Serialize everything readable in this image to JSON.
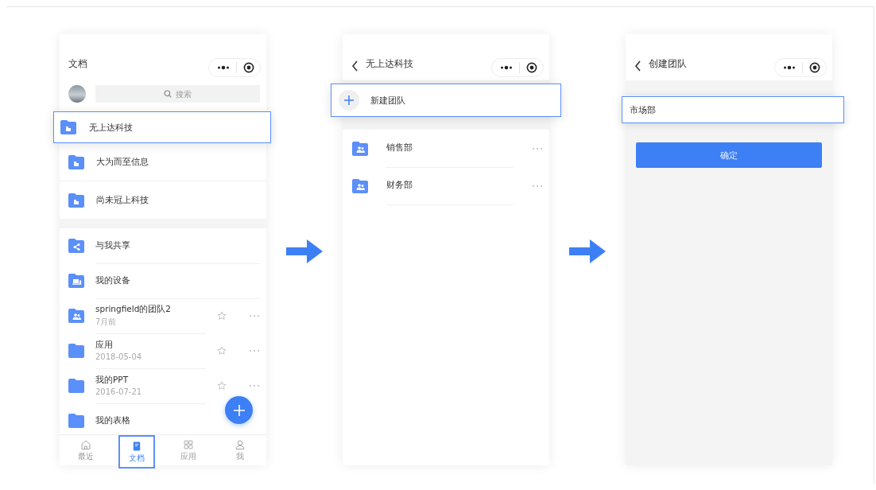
{
  "screens": [
    {
      "kind": "documents",
      "title": "文档",
      "search": {
        "placeholder": "搜索"
      },
      "teams": [
        {
          "name": "无上达科技",
          "highlighted": true
        },
        {
          "name": "大为而至信息",
          "highlighted": false
        },
        {
          "name": "尚未冠上科技",
          "highlighted": false
        }
      ],
      "files": [
        {
          "kind": "shared",
          "name": "与我共享",
          "actions": false
        },
        {
          "kind": "device",
          "name": "我的设备",
          "actions": false
        },
        {
          "kind": "team",
          "name": "springfield的团队2",
          "meta": "7月前",
          "actions": true
        },
        {
          "kind": "folder",
          "name": "应用",
          "meta": "2018-05-04",
          "actions": true
        },
        {
          "kind": "folder",
          "name": "我的PPT",
          "meta": "2016-07-21",
          "actions": true
        },
        {
          "kind": "folder",
          "name": "我的表格",
          "actions": false
        }
      ],
      "tabs": [
        {
          "label": "最近",
          "selected": false,
          "highlighted": false
        },
        {
          "label": "文档",
          "selected": true,
          "highlighted": true
        },
        {
          "label": "应用",
          "selected": false,
          "highlighted": false
        },
        {
          "label": "我",
          "selected": false,
          "highlighted": false
        }
      ]
    },
    {
      "kind": "team",
      "title": "无上达科技",
      "new_button": {
        "label": "新建团队",
        "highlighted": true
      },
      "departments": [
        {
          "name": "销售部"
        },
        {
          "name": "财务部"
        }
      ]
    },
    {
      "kind": "form",
      "title": "创建团队",
      "field": {
        "value": "市场部",
        "highlighted": true
      },
      "button": "确定"
    }
  ]
}
